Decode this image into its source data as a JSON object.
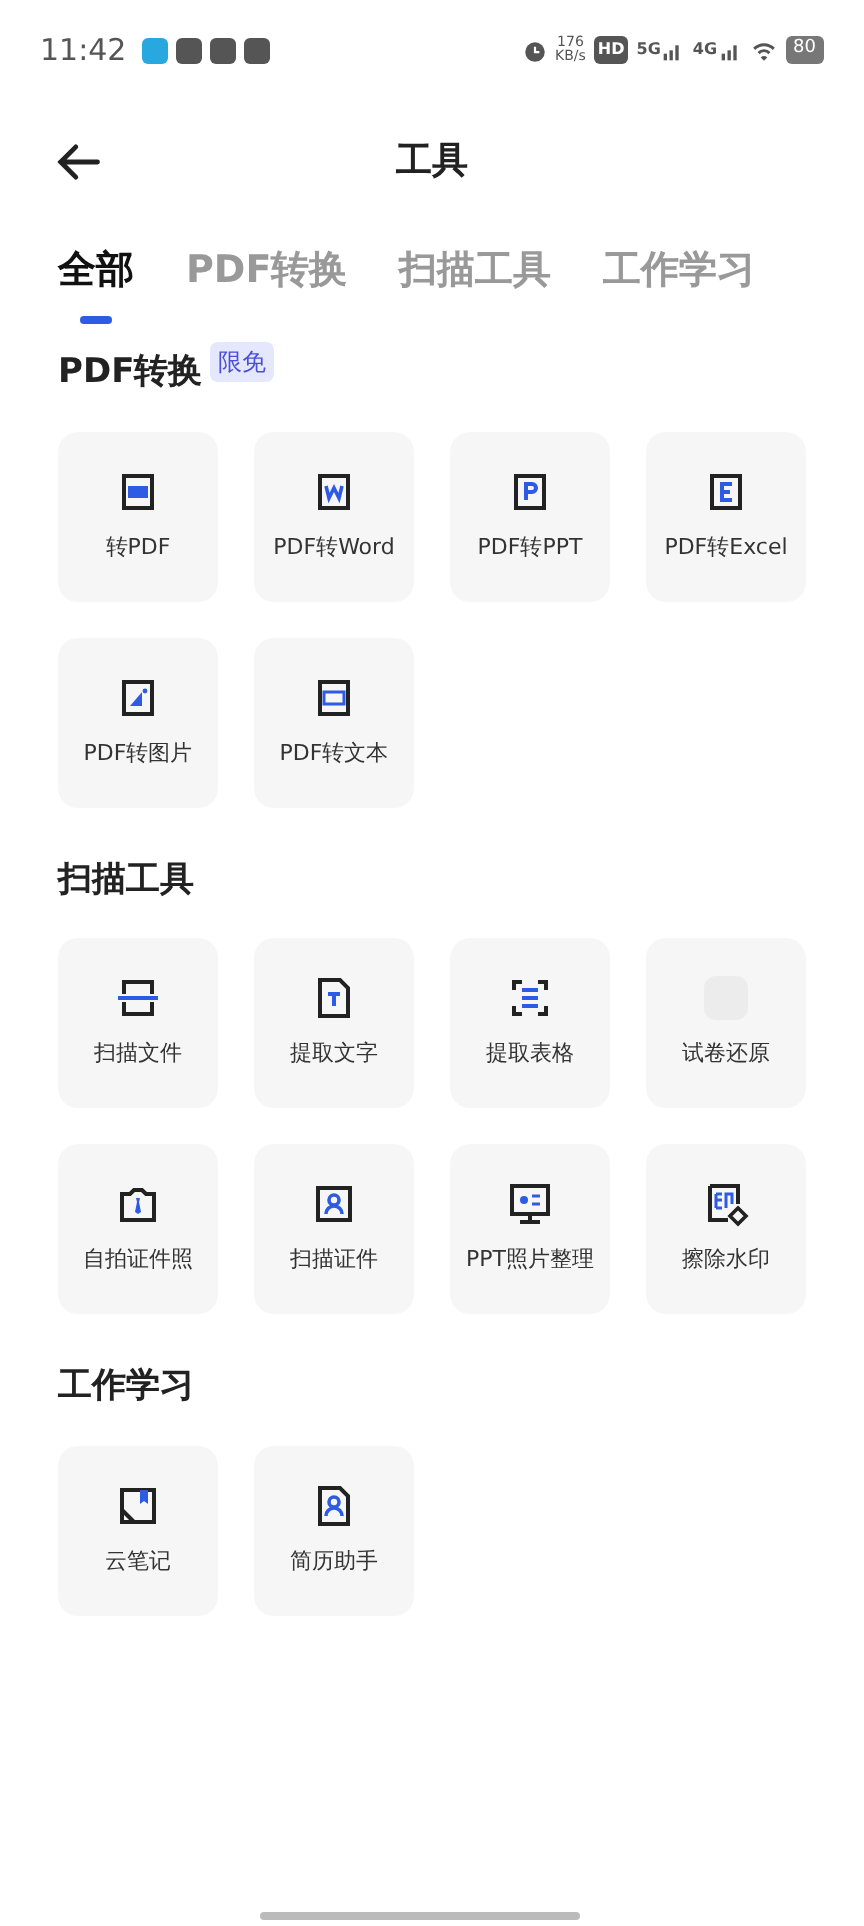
{
  "status_bar": {
    "time": "11:42",
    "speed_value": "176",
    "speed_unit": "KB/s",
    "hd": "HD",
    "networks": [
      "5G",
      "4G"
    ],
    "battery": "80"
  },
  "header": {
    "title": "工具"
  },
  "tabs": [
    {
      "label": "全部",
      "selected": true
    },
    {
      "label": "PDF转换",
      "selected": false
    },
    {
      "label": "扫描工具",
      "selected": false
    },
    {
      "label": "工作学习",
      "selected": false
    }
  ],
  "sections": [
    {
      "title": "PDF转换",
      "badge": "限免",
      "tools": [
        {
          "label": "转PDF",
          "kind": "pdf"
        },
        {
          "label": "PDF转Word",
          "kind": "word"
        },
        {
          "label": "PDF转PPT",
          "kind": "ppt"
        },
        {
          "label": "PDF转Excel",
          "kind": "excel"
        },
        {
          "label": "PDF转图片",
          "kind": "image"
        },
        {
          "label": "PDF转文本",
          "kind": "txt"
        }
      ]
    },
    {
      "title": "扫描工具",
      "tools": [
        {
          "label": "扫描文件",
          "kind": "scan"
        },
        {
          "label": "提取文字",
          "kind": "ocr"
        },
        {
          "label": "提取表格",
          "kind": "table"
        },
        {
          "label": "试卷还原",
          "kind": "blank"
        },
        {
          "label": "自拍证件照",
          "kind": "idphoto"
        },
        {
          "label": "扫描证件",
          "kind": "idcard"
        },
        {
          "label": "PPT照片整理",
          "kind": "screen"
        },
        {
          "label": "擦除水印",
          "kind": "erase"
        }
      ]
    },
    {
      "title": "工作学习",
      "tools": [
        {
          "label": "云笔记",
          "kind": "note"
        },
        {
          "label": "简历助手",
          "kind": "resume"
        }
      ]
    }
  ]
}
